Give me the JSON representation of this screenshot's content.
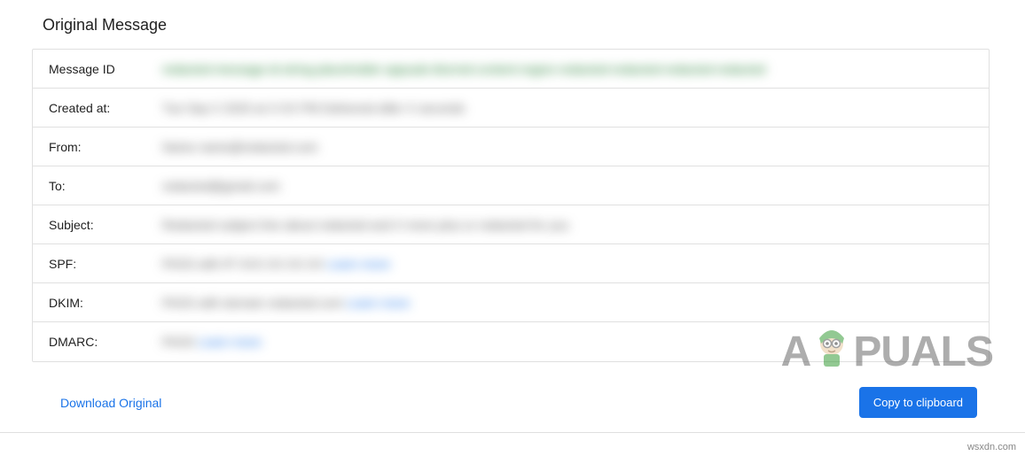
{
  "header": {
    "title": "Original Message"
  },
  "rows": [
    {
      "label": "Message ID",
      "value": "redacted-message-id-string-placeholder-appuals-blurred-content-region-redacted-redacted-redacted-redacted",
      "value_class": "blur-green"
    },
    {
      "label": "Created at:",
      "value": "Tue Sep X 2020 at X:XX PM Delivered after X seconds",
      "value_class": ""
    },
    {
      "label": "From:",
      "value": "Name name@redacted.com",
      "value_class": ""
    },
    {
      "label": "To:",
      "value": "redacted@gmail.com",
      "value_class": ""
    },
    {
      "label": "Subject:",
      "value": "Redacted subject line about redacted and X more plus or redacted for you",
      "value_class": ""
    },
    {
      "label": "SPF:",
      "value": "PASS with IP XXX.XX.XX.XX",
      "link": "Learn more",
      "value_class": ""
    },
    {
      "label": "DKIM:",
      "value": "PASS with domain redacted.com",
      "link": "Learn more",
      "value_class": ""
    },
    {
      "label": "DMARC:",
      "value": "PASS",
      "link": "Learn more",
      "value_class": ""
    }
  ],
  "actions": {
    "download_label": "Download Original",
    "copy_label": "Copy to clipboard"
  },
  "watermark": {
    "logo_left": "A",
    "logo_right": "PUALS",
    "site": "wsxdn.com"
  }
}
